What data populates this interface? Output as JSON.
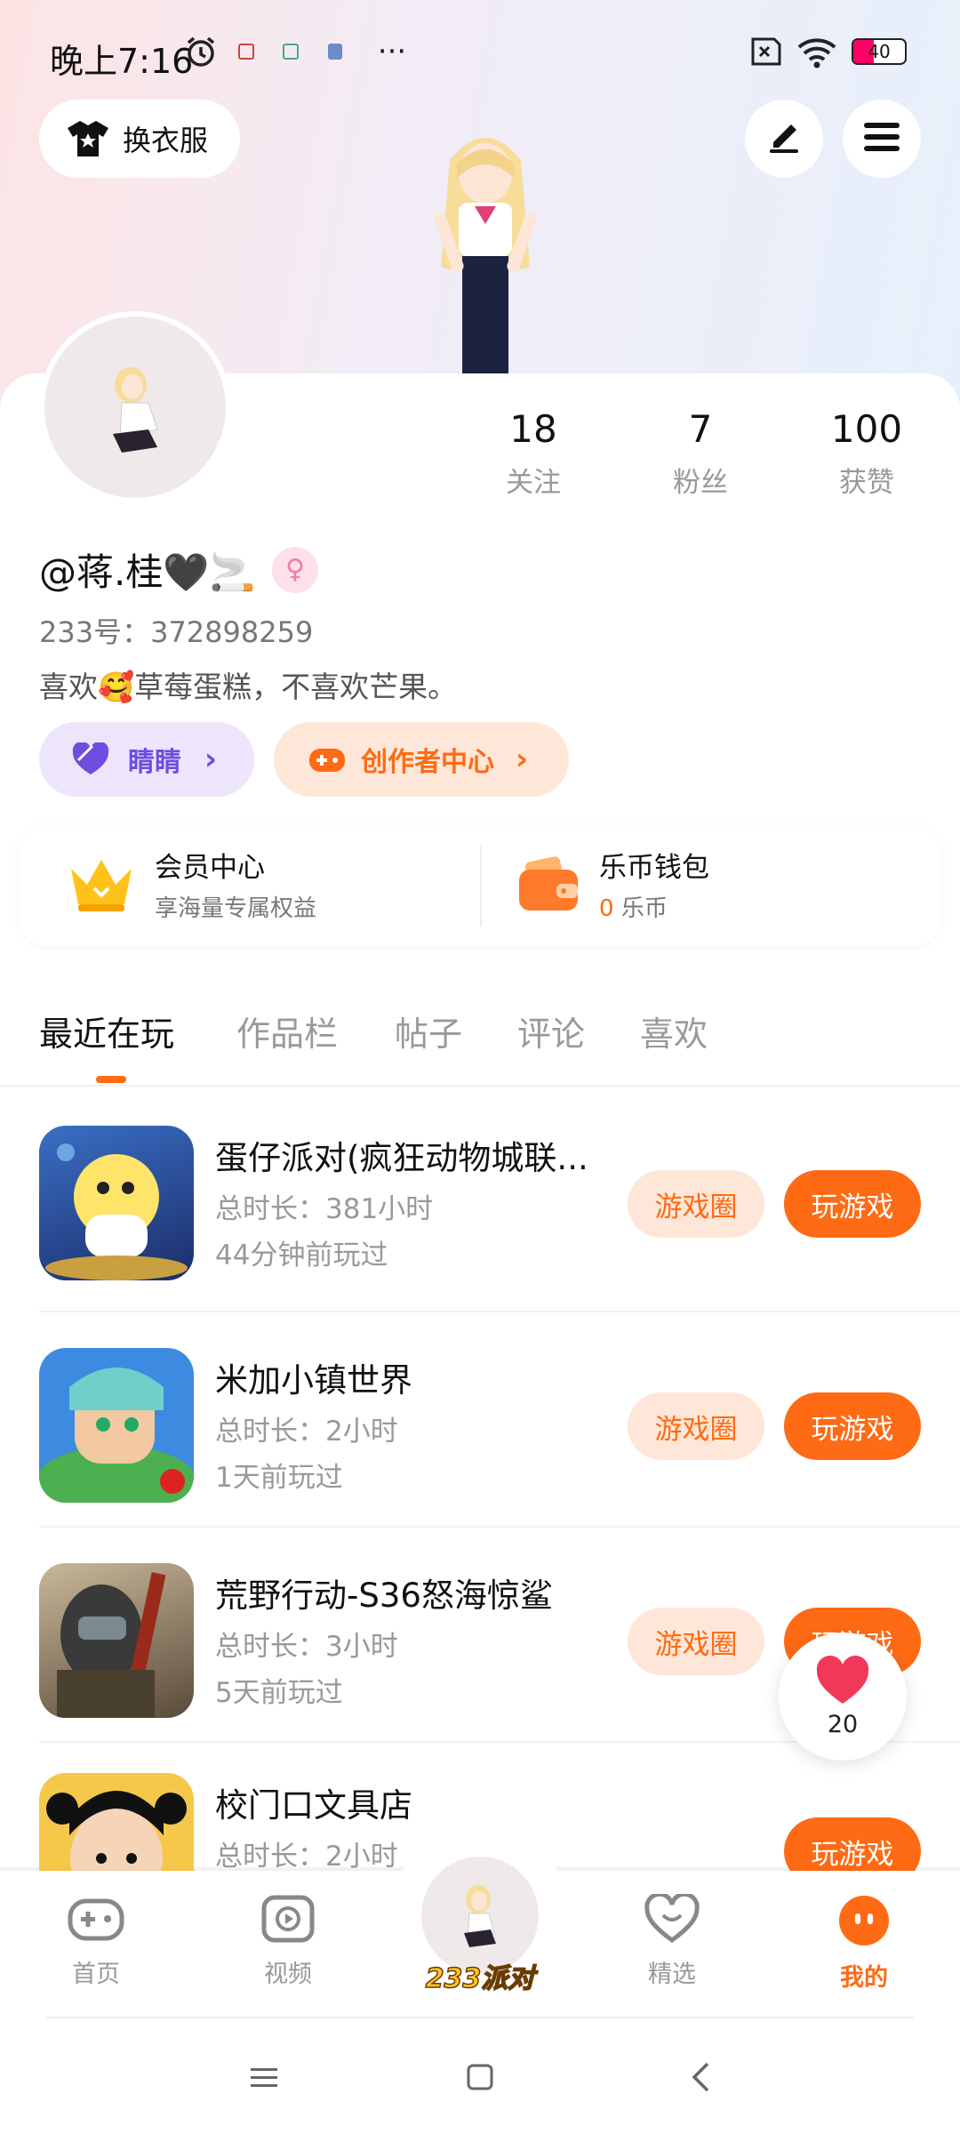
{
  "status": {
    "time": "晚上7:16",
    "battery": "40",
    "more": "···"
  },
  "header": {
    "outfit_label": "换衣服",
    "edit_icon": "edit-icon",
    "menu_icon": "menu-icon"
  },
  "profile": {
    "stats": [
      {
        "value": "18",
        "label": "关注"
      },
      {
        "value": "7",
        "label": "粉丝"
      },
      {
        "value": "100",
        "label": "获赞"
      }
    ],
    "username": "@蒋.桂🖤🚬",
    "uid": "233号：372898259",
    "bio": "喜欢🥰草莓蛋糕，不喜欢芒果。",
    "pill_friend": "睛睛",
    "pill_creator": "创作者中心"
  },
  "benefits": {
    "vip_title": "会员中心",
    "vip_sub": "享海量专属权益",
    "wallet_title": "乐币钱包",
    "wallet_amount": "0",
    "wallet_unit": "乐币"
  },
  "tabs": [
    "最近在玩",
    "作品栏",
    "帖子",
    "评论",
    "喜欢"
  ],
  "games": [
    {
      "name": "蛋仔派对(疯狂动物城联...",
      "duration": "总时长：381小时",
      "last": "44分钟前玩过",
      "circle": "游戏圈",
      "play": "玩游戏"
    },
    {
      "name": "米加小镇世界",
      "duration": "总时长：2小时",
      "last": "1天前玩过",
      "circle": "游戏圈",
      "play": "玩游戏"
    },
    {
      "name": "荒野行动-S36怒海惊鲨",
      "duration": "总时长：3小时",
      "last": "5天前玩过",
      "circle": "游戏圈",
      "play": "玩游戏"
    },
    {
      "name": "校门口文具店",
      "duration": "总时长：2小时",
      "last": "",
      "circle": "",
      "play": "玩游戏"
    }
  ],
  "like_count": "20",
  "bottom_nav": [
    {
      "label": "首页"
    },
    {
      "label": "视频"
    },
    {
      "label": "233派对"
    },
    {
      "label": "精选"
    },
    {
      "label": "我的"
    }
  ],
  "colors": {
    "accent": "#ff6a14",
    "accent_light": "#fee7d8",
    "purple": "#6e4de0"
  }
}
